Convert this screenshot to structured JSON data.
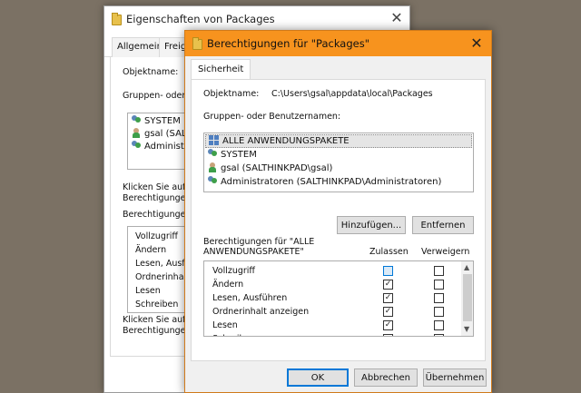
{
  "back_window": {
    "title": "Eigenschaften von Packages",
    "tabs": [
      "Allgemein",
      "Freig"
    ],
    "object_label": "Objektname:",
    "groups_label": "Gruppen- oder B",
    "users": [
      {
        "name": "SYSTEM",
        "icon": "users-icon"
      },
      {
        "name": "gsal (SALTHI",
        "icon": "user-icon"
      },
      {
        "name": "Administrator",
        "icon": "users-icon"
      }
    ],
    "hint1_line1": "Klicken Sie auf \"E",
    "hint1_line2": "Berechtigungen z",
    "perms_label": "Berechtigungen f",
    "perms": [
      "Vollzugriff",
      "Ändern",
      "Lesen, Ausfüh",
      "Ordnerinhalt a",
      "Lesen",
      "Schreiben"
    ],
    "hint2_line1": "Klicken Sie auf \"E",
    "hint2_line2": "Berechtigungen a"
  },
  "front_window": {
    "title": "Berechtigungen für \"Packages\"",
    "tab": "Sicherheit",
    "object_label": "Objektname:",
    "object_value": "C:\\Users\\gsal\\appdata\\local\\Packages",
    "groups_label": "Gruppen- oder Benutzernamen:",
    "groups": [
      {
        "name": "ALLE ANWENDUNGSPAKETE",
        "icon": "package-grid-icon",
        "selected": true
      },
      {
        "name": "SYSTEM",
        "icon": "users-icon",
        "selected": false
      },
      {
        "name": "gsal (SALTHINKPAD\\gsal)",
        "icon": "user-icon",
        "selected": false
      },
      {
        "name": "Administratoren (SALTHINKPAD\\Administratoren)",
        "icon": "users-icon",
        "selected": false
      }
    ],
    "add_button": "Hinzufügen...",
    "remove_button": "Entfernen",
    "perms_header_line1": "Berechtigungen für \"ALLE",
    "perms_header_line2": "ANWENDUNGSPAKETE\"",
    "allow_col": "Zulassen",
    "deny_col": "Verweigern",
    "permissions": [
      {
        "name": "Vollzugriff",
        "allow": false,
        "deny": false
      },
      {
        "name": "Ändern",
        "allow": true,
        "deny": false
      },
      {
        "name": "Lesen, Ausführen",
        "allow": true,
        "deny": false
      },
      {
        "name": "Ordnerinhalt anzeigen",
        "allow": true,
        "deny": false
      },
      {
        "name": "Lesen",
        "allow": true,
        "deny": false
      },
      {
        "name": "Schreiben",
        "allow": false,
        "deny": false
      }
    ],
    "ok_button": "OK",
    "cancel_button": "Abbrechen",
    "apply_button": "Übernehmen",
    "accent_color": "#f7931e"
  }
}
